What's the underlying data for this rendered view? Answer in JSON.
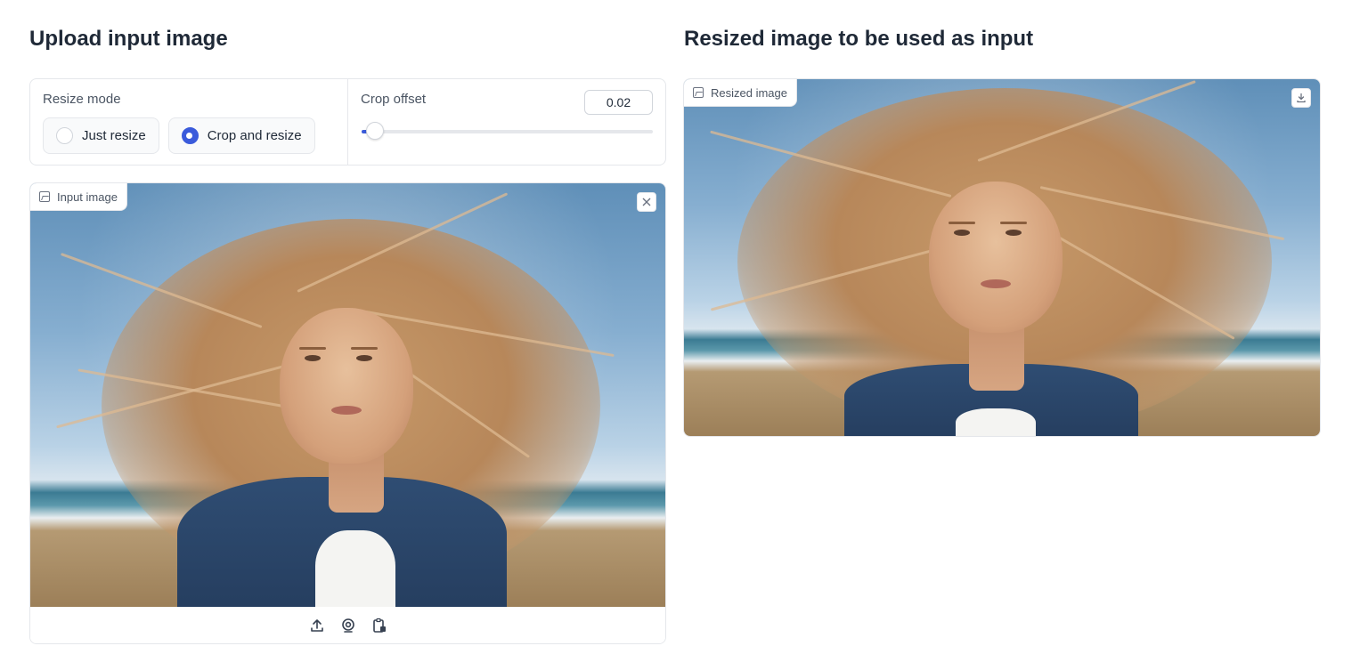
{
  "left": {
    "heading": "Upload input image",
    "resize_mode": {
      "label": "Resize mode",
      "options": [
        {
          "label": "Just resize",
          "selected": false
        },
        {
          "label": "Crop and resize",
          "selected": true
        }
      ]
    },
    "crop_offset": {
      "label": "Crop offset",
      "value": "0.02",
      "slider_fraction": 0.02
    },
    "input_image": {
      "tag_label": "Input image",
      "toolbar_icons": [
        "upload-icon",
        "webcam-icon",
        "clipboard-icon"
      ],
      "close_icon": "close-icon"
    }
  },
  "right": {
    "heading": "Resized image to be used as input",
    "resized_image": {
      "tag_label": "Resized image",
      "download_icon": "download-icon"
    }
  },
  "colors": {
    "accent": "#3b5bdb",
    "border": "#e5e7eb",
    "text": "#1f2937",
    "muted": "#4b5563"
  }
}
